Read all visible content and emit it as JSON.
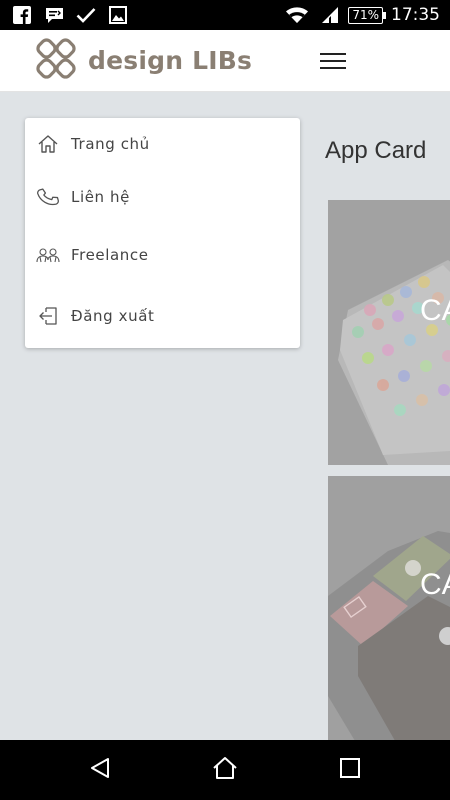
{
  "status_bar": {
    "left_icons": [
      "facebook-icon",
      "message-icon",
      "check-icon",
      "image-icon"
    ],
    "battery": "71%",
    "time": "17:35"
  },
  "header": {
    "brand": "design LIBs",
    "menu_icon": "hamburger-icon"
  },
  "main": {
    "title": "App Card",
    "cards": [
      {
        "label": "CA"
      },
      {
        "label": "CA"
      }
    ]
  },
  "menu": {
    "items": [
      {
        "label": "Trang chủ",
        "icon": "home-icon"
      },
      {
        "label": "Liên hệ",
        "icon": "phone-icon"
      },
      {
        "label": "Freelance",
        "icon": "people-icon"
      },
      {
        "label": "Đăng xuất",
        "icon": "logout-icon"
      }
    ]
  },
  "nav_bar": {
    "buttons": [
      "back-icon",
      "home-icon",
      "recents-icon"
    ]
  },
  "colors": {
    "brand": "#8a7f73",
    "background": "#dfe3e6",
    "text": "#444444"
  }
}
